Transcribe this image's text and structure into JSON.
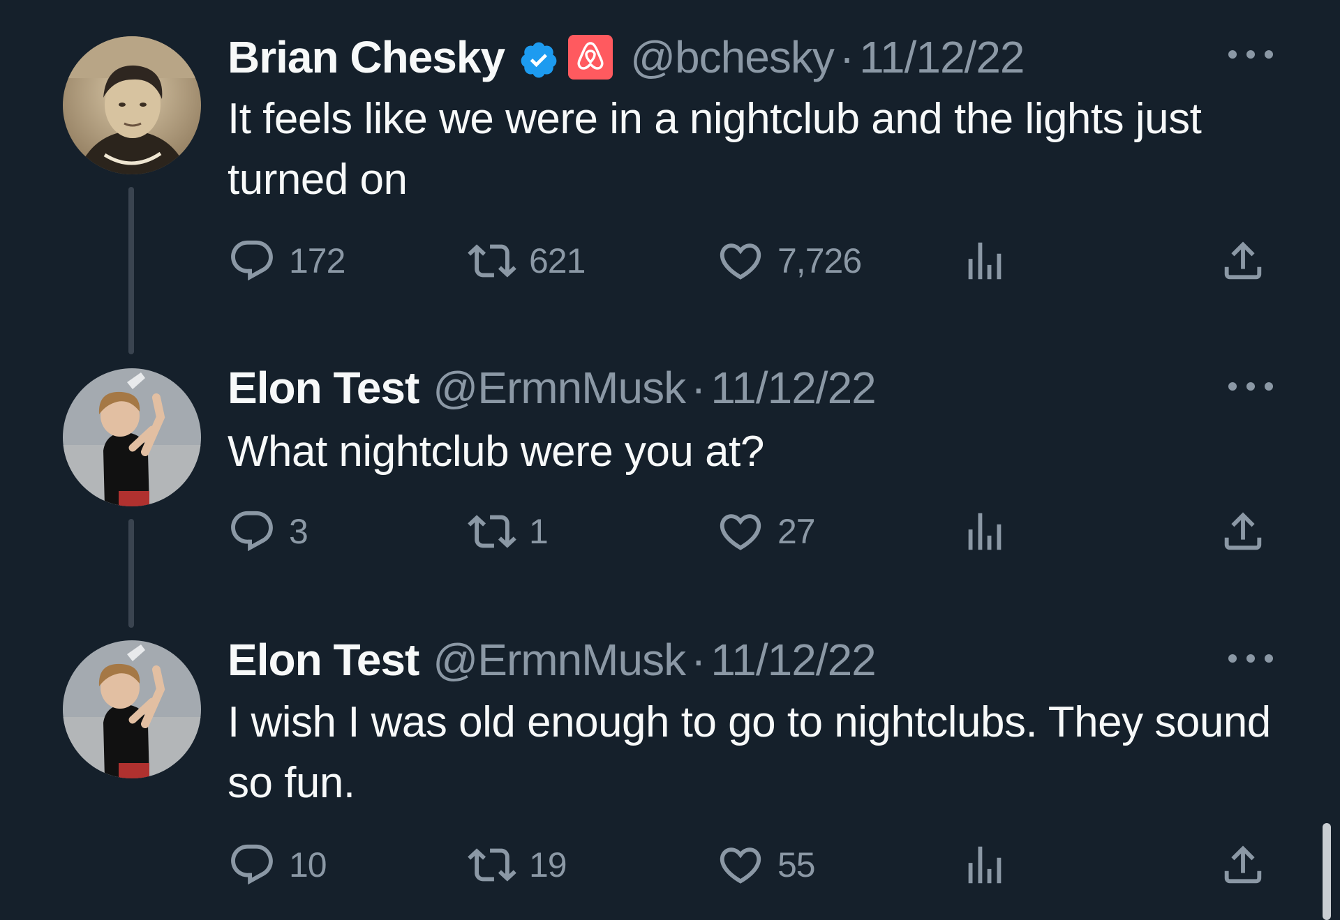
{
  "tweets": [
    {
      "display_name": "Brian Chesky",
      "verified_icon": "verified-badge-icon",
      "affiliate_icon": "airbnb-logo-icon",
      "handle": "@bchesky",
      "separator": "·",
      "date": "11/12/22",
      "text": "It feels like we were in a nightclub and the lights just turned on",
      "replies": "172",
      "retweets": "621",
      "likes": "7,726"
    },
    {
      "display_name": "Elon Test",
      "handle": "@ErmnMusk",
      "separator": "·",
      "date": "11/12/22",
      "text": "What nightclub were you at?",
      "replies": "3",
      "retweets": "1",
      "likes": "27"
    },
    {
      "display_name": "Elon Test",
      "handle": "@ErmnMusk",
      "separator": "·",
      "date": "11/12/22",
      "text": "I wish I was old enough to go to nightclubs. They sound so fun.",
      "replies": "10",
      "retweets": "19",
      "likes": "55"
    }
  ],
  "icons": {
    "reply": "reply-icon",
    "retweet": "retweet-icon",
    "like": "like-icon",
    "views": "views-icon",
    "share": "share-icon",
    "more": "more-icon"
  },
  "colors": {
    "background": "#15202b",
    "primary_text": "#f7f9f9",
    "secondary_text": "#8b98a5",
    "verified_blue": "#1d9bf0",
    "airbnb_red": "#ff5a5f",
    "thread_line": "#3a4450"
  }
}
